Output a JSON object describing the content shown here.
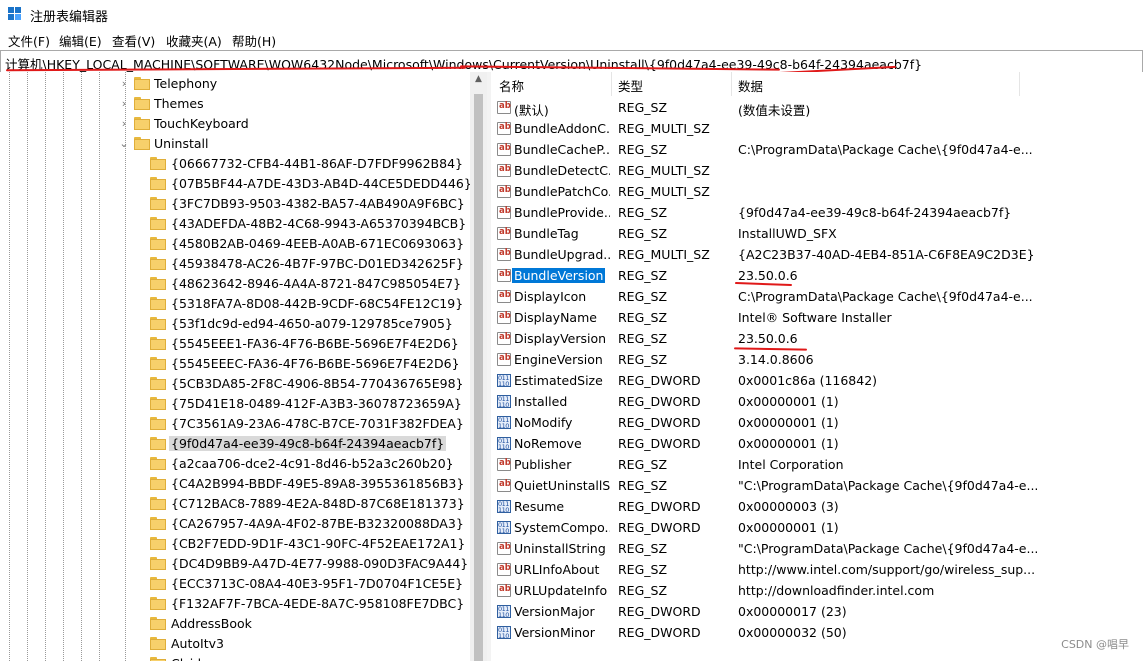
{
  "window": {
    "title": "注册表编辑器"
  },
  "menu": [
    "文件(F)",
    "编辑(E)",
    "查看(V)",
    "收藏夹(A)",
    "帮助(H)"
  ],
  "address": "计算机\\HKEY_LOCAL_MACHINE\\SOFTWARE\\WOW6432Node\\Microsoft\\Windows\\CurrentVersion\\Uninstall\\{9f0d47a4-ee39-49c8-b64f-24394aeacb7f}",
  "tree": [
    {
      "label": "Telephony",
      "chevron": "›"
    },
    {
      "label": "Themes",
      "chevron": "›"
    },
    {
      "label": "TouchKeyboard",
      "chevron": "›"
    },
    {
      "label": "Uninstall",
      "chevron": "⌄"
    },
    {
      "label": "{06667732-CFB4-44B1-86AF-D7FDF9962B84}",
      "chevron": ""
    },
    {
      "label": "{07B5BF44-A7DE-43D3-AB4D-44CE5DEDD446}",
      "chevron": ""
    },
    {
      "label": "{3FC7DB93-9503-4382-BA57-4AB490A9F6BC}",
      "chevron": ""
    },
    {
      "label": "{43ADEFDA-48B2-4C68-9943-A65370394BCB}",
      "chevron": ""
    },
    {
      "label": "{4580B2AB-0469-4EEB-A0AB-671EC0693063}",
      "chevron": ""
    },
    {
      "label": "{45938478-AC26-4B7F-97BC-D01ED342625F}",
      "chevron": ""
    },
    {
      "label": "{48623642-8946-4A4A-8721-847C985054E7}",
      "chevron": ""
    },
    {
      "label": "{5318FA7A-8D08-442B-9CDF-68C54FE12C19}",
      "chevron": ""
    },
    {
      "label": "{53f1dc9d-ed94-4650-a079-129785ce7905}",
      "chevron": ""
    },
    {
      "label": "{5545EEE1-FA36-4F76-B6BE-5696E7F4E2D6}",
      "chevron": ""
    },
    {
      "label": "{5545EEEC-FA36-4F76-B6BE-5696E7F4E2D6}",
      "chevron": ""
    },
    {
      "label": "{5CB3DA85-2F8C-4906-8B54-770436765E98}",
      "chevron": ""
    },
    {
      "label": "{75D41E18-0489-412F-A3B3-36078723659A}",
      "chevron": ""
    },
    {
      "label": "{7C3561A9-23A6-478C-B7CE-7031F382FDEA}",
      "chevron": ""
    },
    {
      "label": "{9f0d47a4-ee39-49c8-b64f-24394aeacb7f}",
      "chevron": "",
      "selected": true
    },
    {
      "label": "{a2caa706-dce2-4c91-8d46-b52a3c260b20}",
      "chevron": ""
    },
    {
      "label": "{C4A2B994-BBDF-49E5-89A8-3955361856B3}",
      "chevron": ""
    },
    {
      "label": "{C712BAC8-7889-4E2A-848D-87C68E181373}",
      "chevron": ""
    },
    {
      "label": "{CA267957-4A9A-4F02-87BE-B32320088DA3}",
      "chevron": ""
    },
    {
      "label": "{CB2F7EDD-9D1F-43C1-90FC-4F52EAE172A1}",
      "chevron": ""
    },
    {
      "label": "{DC4D9BB9-A47D-4E77-9988-090D3FAC9A44}",
      "chevron": ""
    },
    {
      "label": "{ECC3713C-08A4-40E3-95F1-7D0704F1CE5E}",
      "chevron": ""
    },
    {
      "label": "{F132AF7F-7BCA-4EDE-8A7C-958108FE7DBC}",
      "chevron": ""
    },
    {
      "label": "AddressBook",
      "chevron": ""
    },
    {
      "label": "AutoItv3",
      "chevron": ""
    },
    {
      "label": "Clsid",
      "chevron": ""
    }
  ],
  "columns": {
    "name": "名称",
    "type": "类型",
    "data": "数据"
  },
  "values": [
    {
      "name": "(默认)",
      "type": "REG_SZ",
      "data": "(数值未设置)"
    },
    {
      "name": "BundleAddonC...",
      "type": "REG_MULTI_SZ",
      "data": ""
    },
    {
      "name": "BundleCacheP...",
      "type": "REG_SZ",
      "data": "C:\\ProgramData\\Package Cache\\{9f0d47a4-e..."
    },
    {
      "name": "BundleDetectC...",
      "type": "REG_MULTI_SZ",
      "data": ""
    },
    {
      "name": "BundlePatchCo...",
      "type": "REG_MULTI_SZ",
      "data": ""
    },
    {
      "name": "BundleProvide...",
      "type": "REG_SZ",
      "data": "{9f0d47a4-ee39-49c8-b64f-24394aeacb7f}"
    },
    {
      "name": "BundleTag",
      "type": "REG_SZ",
      "data": "InstallUWD_SFX"
    },
    {
      "name": "BundleUpgrad...",
      "type": "REG_MULTI_SZ",
      "data": "{A2C23B37-40AD-4EB4-851A-C6F8EA9C2D3E}"
    },
    {
      "name": "BundleVersion",
      "type": "REG_SZ",
      "data": "23.50.0.6",
      "selected": true
    },
    {
      "name": "DisplayIcon",
      "type": "REG_SZ",
      "data": "C:\\ProgramData\\Package Cache\\{9f0d47a4-e..."
    },
    {
      "name": "DisplayName",
      "type": "REG_SZ",
      "data": "Intel® Software Installer"
    },
    {
      "name": "DisplayVersion",
      "type": "REG_SZ",
      "data": "23.50.0.6"
    },
    {
      "name": "EngineVersion",
      "type": "REG_SZ",
      "data": "3.14.0.8606"
    },
    {
      "name": "EstimatedSize",
      "type": "REG_DWORD",
      "data": "0x0001c86a (116842)"
    },
    {
      "name": "Installed",
      "type": "REG_DWORD",
      "data": "0x00000001 (1)"
    },
    {
      "name": "NoModify",
      "type": "REG_DWORD",
      "data": "0x00000001 (1)"
    },
    {
      "name": "NoRemove",
      "type": "REG_DWORD",
      "data": "0x00000001 (1)"
    },
    {
      "name": "Publisher",
      "type": "REG_SZ",
      "data": "Intel Corporation"
    },
    {
      "name": "QuietUninstallS...",
      "type": "REG_SZ",
      "data": "\"C:\\ProgramData\\Package Cache\\{9f0d47a4-e..."
    },
    {
      "name": "Resume",
      "type": "REG_DWORD",
      "data": "0x00000003 (3)"
    },
    {
      "name": "SystemCompo...",
      "type": "REG_DWORD",
      "data": "0x00000001 (1)"
    },
    {
      "name": "UninstallString",
      "type": "REG_SZ",
      "data": "\"C:\\ProgramData\\Package Cache\\{9f0d47a4-e..."
    },
    {
      "name": "URLInfoAbout",
      "type": "REG_SZ",
      "data": "http://www.intel.com/support/go/wireless_sup..."
    },
    {
      "name": "URLUpdateInfo",
      "type": "REG_SZ",
      "data": "http://downloadfinder.intel.com"
    },
    {
      "name": "VersionMajor",
      "type": "REG_DWORD",
      "data": "0x00000017 (23)"
    },
    {
      "name": "VersionMinor",
      "type": "REG_DWORD",
      "data": "0x00000032 (50)"
    }
  ],
  "watermark": "CSDN @唱早",
  "colors": {
    "selection": "#0078d7",
    "annotation": "#e01919",
    "folder": "#f7d06b"
  }
}
